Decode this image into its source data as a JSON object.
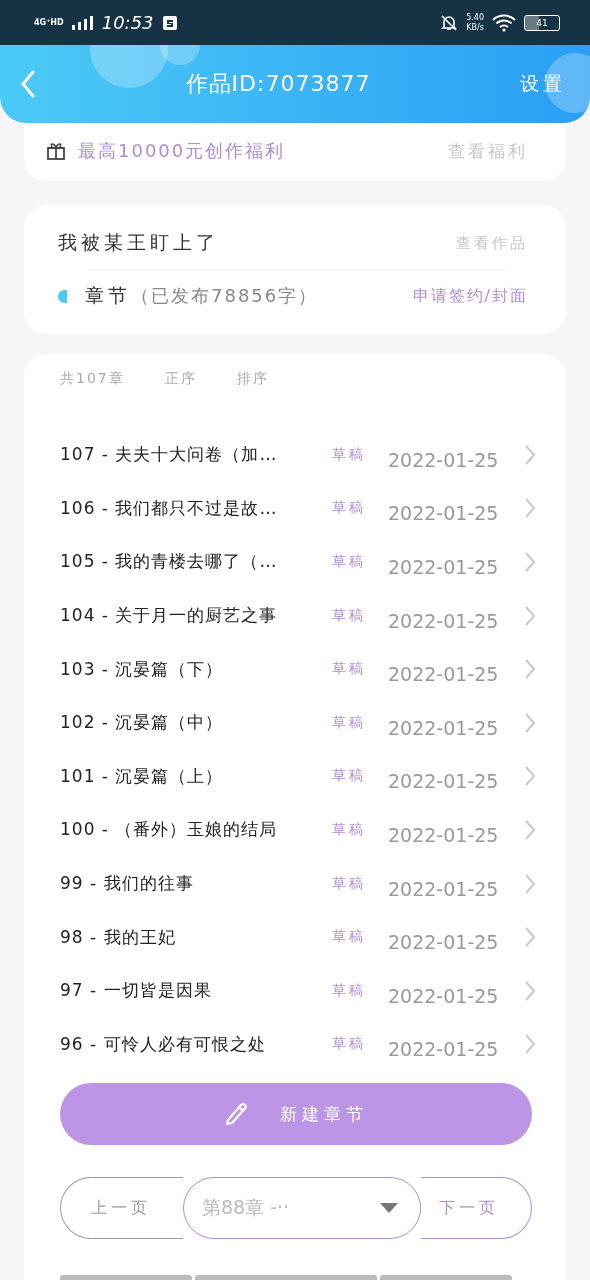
{
  "status_bar": {
    "network": "4G⁺HD",
    "time": "10:53",
    "speed": "5.40",
    "speed_unit": "KB/s",
    "battery": "41"
  },
  "header": {
    "title": "作品ID:7073877",
    "settings": "设置"
  },
  "promo": {
    "text": "最高10000元创作福利",
    "link": "查看福利"
  },
  "work": {
    "title": "我被某王盯上了",
    "view": "查看作品",
    "chapters_label": "章节",
    "published": "（已发布78856字）",
    "apply": "申请签约/封面"
  },
  "list_header": {
    "total": "共107章",
    "sort_options": [
      {
        "label": "正序",
        "selected": false
      },
      {
        "label": "排序",
        "selected": false
      }
    ]
  },
  "chapters": [
    {
      "title": "107 - 夫夫十大问卷（加…",
      "status": "草稿",
      "date": "2022-01-25"
    },
    {
      "title": "106 - 我们都只不过是故…",
      "status": "草稿",
      "date": "2022-01-25"
    },
    {
      "title": "105 - 我的青楼去哪了（…",
      "status": "草稿",
      "date": "2022-01-25"
    },
    {
      "title": "104 - 关于月一的厨艺之事",
      "status": "草稿",
      "date": "2022-01-25"
    },
    {
      "title": "103 - 沉晏篇（下）",
      "status": "草稿",
      "date": "2022-01-25"
    },
    {
      "title": "102 - 沉晏篇（中）",
      "status": "草稿",
      "date": "2022-01-25"
    },
    {
      "title": "101 - 沉晏篇（上）",
      "status": "草稿",
      "date": "2022-01-25"
    },
    {
      "title": "100 - （番外）玉娘的结局",
      "status": "草稿",
      "date": "2022-01-25"
    },
    {
      "title": "99 - 我们的往事",
      "status": "草稿",
      "date": "2022-01-25"
    },
    {
      "title": "98 - 我的王妃",
      "status": "草稿",
      "date": "2022-01-25"
    },
    {
      "title": "97 - 一切皆是因果",
      "status": "草稿",
      "date": "2022-01-25"
    },
    {
      "title": "96 - 可怜人必有可恨之处",
      "status": "草稿",
      "date": "2022-01-25"
    }
  ],
  "new_chapter_button": "新建章节",
  "pager": {
    "prev": {
      "label": "上一页",
      "disabled": true
    },
    "select": "第88章 -··",
    "next": {
      "label": "下一页",
      "disabled": false
    }
  }
}
